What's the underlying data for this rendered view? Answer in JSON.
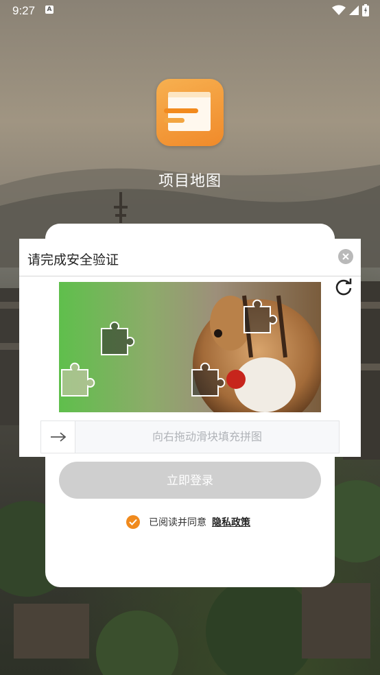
{
  "status_bar": {
    "time": "9:27",
    "notification_badge": "A"
  },
  "app": {
    "name": "项目地图"
  },
  "login": {
    "submit_label": "立即登录",
    "agree_text": "已阅读并同意",
    "policy_link": "隐私政策",
    "agreed": true
  },
  "captcha": {
    "title": "请完成安全验证",
    "slider_hint": "向右拖动滑块填充拼图"
  },
  "colors": {
    "accent": "#f08a1d",
    "button_disabled": "#cfcfcf"
  },
  "icons": [
    "wifi-icon",
    "signal-icon",
    "battery-icon",
    "close-icon",
    "refresh-icon",
    "arrow-right-icon",
    "check-icon"
  ]
}
